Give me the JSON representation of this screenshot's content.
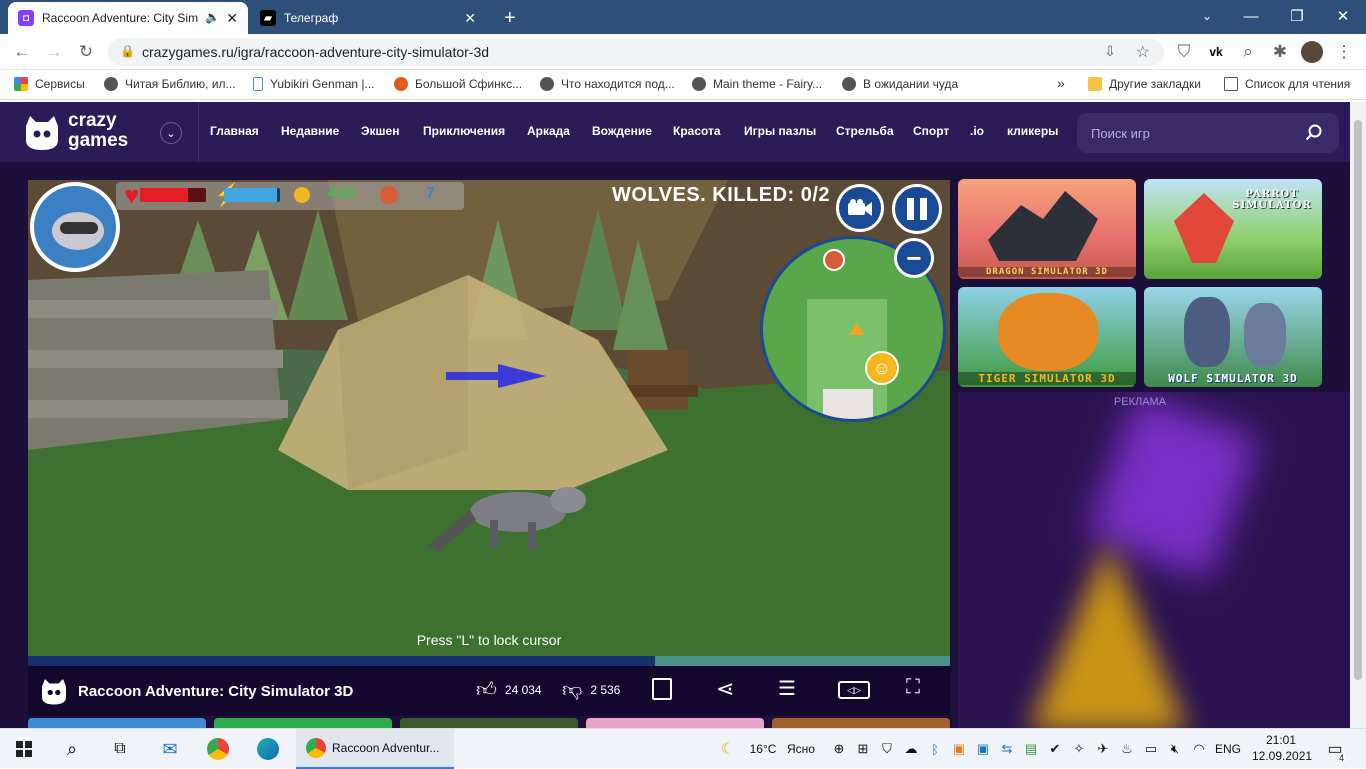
{
  "browser": {
    "tabs": [
      {
        "title": "Raccoon Adventure: City Sim",
        "active": true
      },
      {
        "title": "Телеграф",
        "active": false
      }
    ],
    "new_tab": "+",
    "url": "crazygames.ru/igra/raccoon-adventure-city-simulator-3d",
    "bookmarks": [
      "Сервисы",
      "Читая Библию, ил...",
      "Yubikiri Genman |...",
      "Большой Сфинкс...",
      "Что находится под...",
      "Main theme - Fairy...",
      "В ожидании чуда"
    ],
    "bookmarks_more": "»",
    "other_bookmarks": "Другие закладки",
    "reading_list": "Список для чтения"
  },
  "site": {
    "logo_line1": "crazy",
    "logo_line2": "games",
    "nav": [
      "Главная",
      "Недавние",
      "Экшен",
      "Приключения",
      "Аркада",
      "Вождение",
      "Красота",
      "Игры пазлы",
      "Стрельба",
      "Спорт",
      ".io",
      "кликеры"
    ],
    "search_placeholder": "Поиск игр"
  },
  "game": {
    "coins": "410",
    "meat": "7",
    "objective": "WOLVES. KILLED: 0/2",
    "hint": "Press \"L\" to lock cursor",
    "health_fraction": 0.72,
    "energy_fraction": 0.95,
    "progress_fraction": 0.68
  },
  "gamebar": {
    "title": "Raccoon Adventure: City Simulator 3D",
    "likes": "24 034",
    "dislikes": "2 536"
  },
  "promos": [
    {
      "label": "DRAGON SIMULATOR 3D"
    },
    {
      "label": "PARROT SIMULATOR"
    },
    {
      "label": "TIGER SIMULATOR 3D"
    },
    {
      "label": "WOLF SIMULATOR 3D"
    }
  ],
  "ad_label": "РЕКЛАМА",
  "taskbar": {
    "app_label": "Raccoon Adventur...",
    "weather": "16°C",
    "weather_desc": "Ясно",
    "lang": "ENG",
    "time": "21:01",
    "date": "12.09.2021",
    "notifications": "4"
  }
}
